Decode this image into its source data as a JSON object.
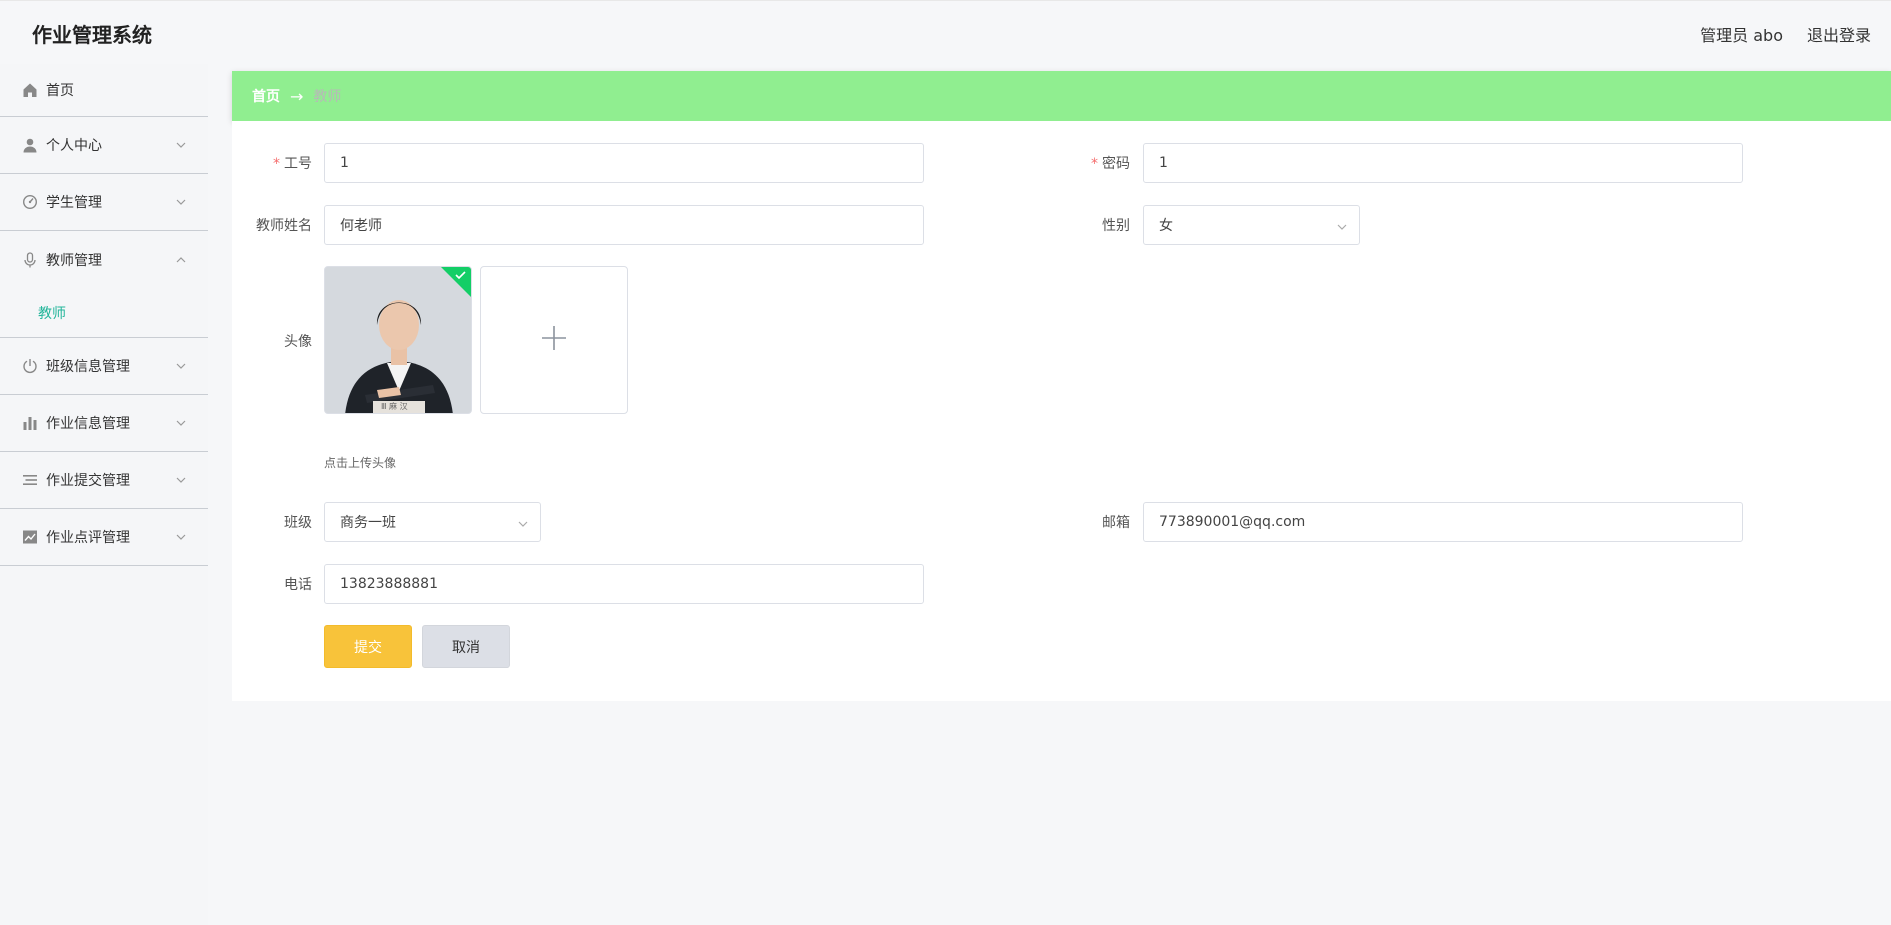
{
  "header": {
    "app_title": "作业管理系统",
    "user_info": "管理员 abo",
    "logout_label": "退出登录"
  },
  "sidebar": {
    "items": [
      {
        "label": "首页",
        "icon": "home-icon"
      },
      {
        "label": "个人中心",
        "icon": "user-icon"
      },
      {
        "label": "学生管理",
        "icon": "dashboard-icon"
      },
      {
        "label": "教师管理",
        "icon": "microphone-icon",
        "expanded": true,
        "children": [
          {
            "label": "教师"
          }
        ]
      },
      {
        "label": "班级信息管理",
        "icon": "power-icon"
      },
      {
        "label": "作业信息管理",
        "icon": "bar-chart-icon"
      },
      {
        "label": "作业提交管理",
        "icon": "list-icon"
      },
      {
        "label": "作业点评管理",
        "icon": "line-chart-icon"
      }
    ]
  },
  "breadcrumb": {
    "home": "首页",
    "separator": "→",
    "current": "教师"
  },
  "form": {
    "job_no": {
      "label": "工号",
      "value": "1",
      "required": true
    },
    "password": {
      "label": "密码",
      "value": "1",
      "required": true
    },
    "teacher_name": {
      "label": "教师姓名",
      "value": "何老师"
    },
    "gender": {
      "label": "性别",
      "value": "女"
    },
    "avatar": {
      "label": "头像",
      "tip": "点击上传头像",
      "badge_text": "Ⅲ 麻 汉"
    },
    "class": {
      "label": "班级",
      "value": "商务一班"
    },
    "email": {
      "label": "邮箱",
      "value": "773890001@qq.com"
    },
    "phone": {
      "label": "电话",
      "value": "13823888881"
    },
    "submit_label": "提交",
    "cancel_label": "取消"
  },
  "colors": {
    "breadcrumb_bg": "#90ee90",
    "active_submenu": "#22b59a",
    "submit_bg": "#f8c33a",
    "cancel_bg": "#dcdfe6",
    "required": "#f56c6c",
    "upload_success": "#13ce66"
  }
}
